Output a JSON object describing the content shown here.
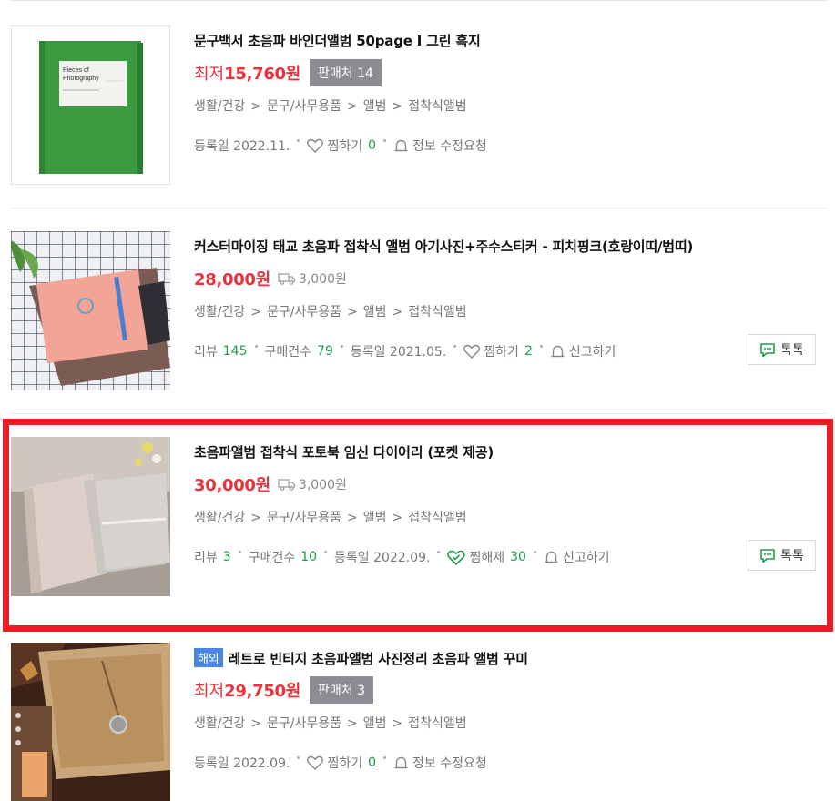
{
  "products": [
    {
      "title": "문구백서 초음파 바인더앨범 50page I 그린 흑지",
      "price_prefix": "최저",
      "price": "15,760원",
      "seller_badge": "판매처 14",
      "category": [
        "생활/건강",
        "문구/사무용품",
        "앨범",
        "접착식앨범"
      ],
      "meta": {
        "date": "등록일 2022.11.",
        "wish_label": "찜하기",
        "wish_count": "0",
        "report_label": "정보 수정요청"
      },
      "thumb_text": [
        "Pieces of",
        "Photography"
      ]
    },
    {
      "title": "커스터마이징 태교 초음파 접착식 앨범 아기사진+주수스티커 - 피치핑크(호랑이띠/범띠)",
      "price": "28,000원",
      "shipping": "3,000원",
      "category": [
        "생활/건강",
        "문구/사무용품",
        "앨범",
        "접착식앨범"
      ],
      "meta": {
        "review_label": "리뷰",
        "review_count": "145",
        "purchase_label": "구매건수",
        "purchase_count": "79",
        "date": "등록일 2021.05.",
        "wish_label": "찜하기",
        "wish_count": "2",
        "report_label": "신고하기"
      },
      "talk_label": "톡톡"
    },
    {
      "title": "초음파앨범 접착식 포토북 임신 다이어리 (포켓 제공)",
      "price": "30,000원",
      "shipping": "3,000원",
      "category": [
        "생활/건강",
        "문구/사무용품",
        "앨범",
        "접착식앨범"
      ],
      "meta": {
        "review_label": "리뷰",
        "review_count": "3",
        "purchase_label": "구매건수",
        "purchase_count": "10",
        "date": "등록일 2022.09.",
        "wish_label": "찜해제",
        "wish_count": "30",
        "report_label": "신고하기"
      },
      "talk_label": "톡톡"
    },
    {
      "overseas_badge": "해외",
      "title": "레트로 빈티지 초음파앨범 사진정리 초음파 앨범 꾸미",
      "price_prefix": "최저",
      "price": "29,750원",
      "seller_badge": "판매처 3",
      "category": [
        "생활/건강",
        "문구/사무용품",
        "앨범",
        "접착식앨범"
      ],
      "meta": {
        "date": "등록일 2022.09.",
        "wish_label": "찜하기",
        "wish_count": "0",
        "report_label": "정보 수정요청"
      }
    }
  ],
  "colors": {
    "price": "#e8333c",
    "count": "#1a9e4b",
    "highlight": "#ed1c24",
    "badge": "#8c8c94",
    "overseas": "#4a86e8"
  }
}
